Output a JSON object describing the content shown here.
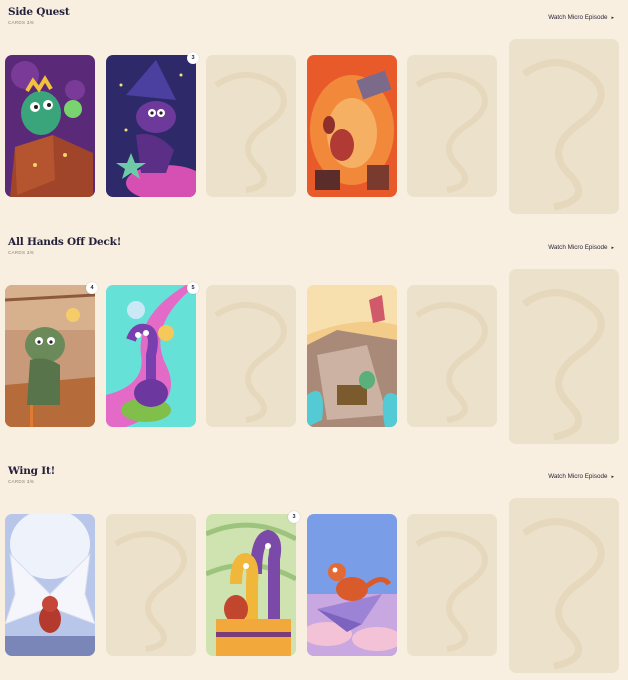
{
  "sections": [
    {
      "title": "Side Quest",
      "subtitle": "CARDS 3/6",
      "watch_label": "Watch Micro Episode",
      "watch_arrow": "▸",
      "badges": [
        "3"
      ]
    },
    {
      "title": "All Hands Off Deck!",
      "subtitle": "CARDS 3/6",
      "watch_label": "Watch Micro Episode",
      "watch_arrow": "▸",
      "badges": [
        "4",
        "5"
      ]
    },
    {
      "title": "Wing It!",
      "subtitle": "CARDS 3/6",
      "watch_label": "Watch Micro Episode",
      "watch_arrow": "▸",
      "badges": [
        "3"
      ]
    }
  ],
  "colors": {
    "background": "#f8efe1",
    "placeholder": "#ece1cb",
    "title": "#24203a"
  }
}
